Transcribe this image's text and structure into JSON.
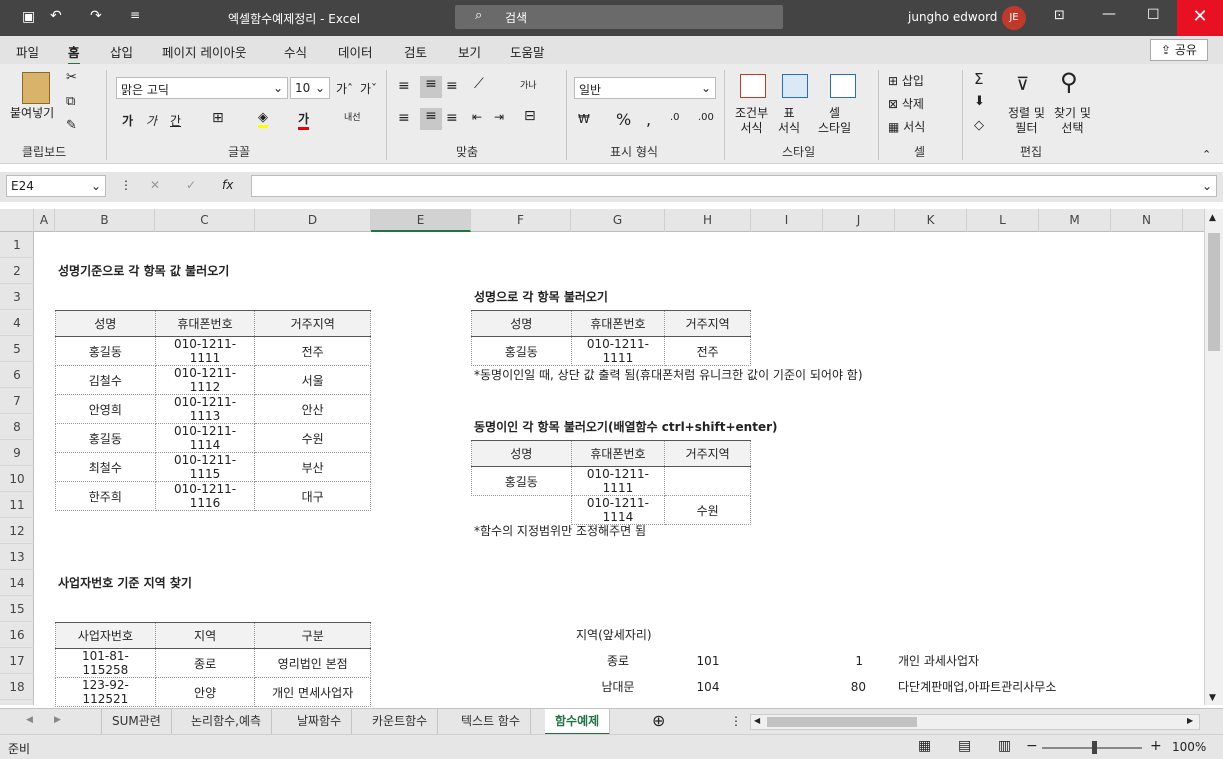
{
  "window": {
    "title": "엑셀함수예제정리  -  Excel",
    "search": "검색",
    "user": "jungho edword",
    "initials": "JE"
  },
  "tabs": [
    "파일",
    "홈",
    "삽입",
    "페이지 레이아웃",
    "수식",
    "데이터",
    "검토",
    "보기",
    "도움말"
  ],
  "share": "공유",
  "ribbon": {
    "paste": "붙여넣기",
    "clipboard": "클립보드",
    "font_name": "맑은 고딕",
    "font_size": "10",
    "font": "글꼴",
    "align": "맞춤",
    "number_format": "일반",
    "number": "표시 형식",
    "cond1": "조건부",
    "cond2": "서식",
    "table1": "표",
    "table2": "서식",
    "cellstyle1": "셀",
    "cellstyle2": "스타일",
    "styles": "스타일",
    "insert": "삽입",
    "delete": "삭제",
    "format": "서식",
    "cells": "셀",
    "sort1": "정렬 및",
    "sort2": "필터",
    "find1": "찾기 및",
    "find2": "선택",
    "editing": "편집",
    "bold": "가",
    "italic": "가",
    "under": "간",
    "wrap": "내선"
  },
  "namebox": "E24",
  "columns": [
    "A",
    "B",
    "C",
    "D",
    "E",
    "F",
    "G",
    "H",
    "I",
    "J",
    "K",
    "L",
    "M",
    "N"
  ],
  "rows": [
    "1",
    "2",
    "3",
    "4",
    "5",
    "6",
    "7",
    "8",
    "9",
    "10",
    "11",
    "12",
    "13",
    "14",
    "15",
    "16",
    "17",
    "18"
  ],
  "headings": {
    "h1": "성명기준으로 각 항목 값 불러오기",
    "h2": "성명으로 각 항목 불러오기",
    "h3": "동명이인 각 항목 불러오기(배열함수 ctrl+shift+enter)",
    "h4": "사업자번호 기준 지역 찾기"
  },
  "notes": {
    "n1": "*동명이인일 때, 상단 값 출력 됨(휴대폰처럼 유니크한 값이 기준이 되어야 함)",
    "n2": "*함수의 지정범위만 조정해주면 됨"
  },
  "table1": {
    "header": [
      "성명",
      "휴대폰번호",
      "거주지역"
    ],
    "rows": [
      [
        "홍길동",
        "010-1211-1111",
        "전주"
      ],
      [
        "김철수",
        "010-1211-1112",
        "서울"
      ],
      [
        "안영희",
        "010-1211-1113",
        "안산"
      ],
      [
        "홍길동",
        "010-1211-1114",
        "수원"
      ],
      [
        "최철수",
        "010-1211-1115",
        "부산"
      ],
      [
        "한주희",
        "010-1211-1116",
        "대구"
      ]
    ]
  },
  "table2": {
    "header": [
      "성명",
      "휴대폰번호",
      "거주지역"
    ],
    "rows": [
      [
        "홍길동",
        "010-1211-1111",
        "전주"
      ]
    ]
  },
  "table3": {
    "header": [
      "성명",
      "휴대폰번호",
      "거주지역"
    ],
    "rows": [
      [
        "홍길동",
        "010-1211-1111",
        ""
      ],
      [
        "",
        "010-1211-1114",
        "수원"
      ]
    ]
  },
  "table4": {
    "header": [
      "사업자번호",
      "지역",
      "구분"
    ],
    "rows": [
      [
        "101-81-115258",
        "종로",
        "영리법인 본점"
      ],
      [
        "123-92-112521",
        "안양",
        "개인 면세사업자"
      ]
    ]
  },
  "region": {
    "title": "지역(앞세자리)",
    "rows": [
      [
        "종로",
        "101",
        "1",
        "개인 과세사업자"
      ],
      [
        "남대문",
        "104",
        "80",
        "다단계판매업,아파트관리사무소"
      ]
    ]
  },
  "sheets": [
    "SUM관련",
    "논리함수,예측",
    "날짜함수",
    "카운트함수",
    "텍스트 함수",
    "함수예제"
  ],
  "status": {
    "ready": "준비",
    "zoom": "100%"
  }
}
